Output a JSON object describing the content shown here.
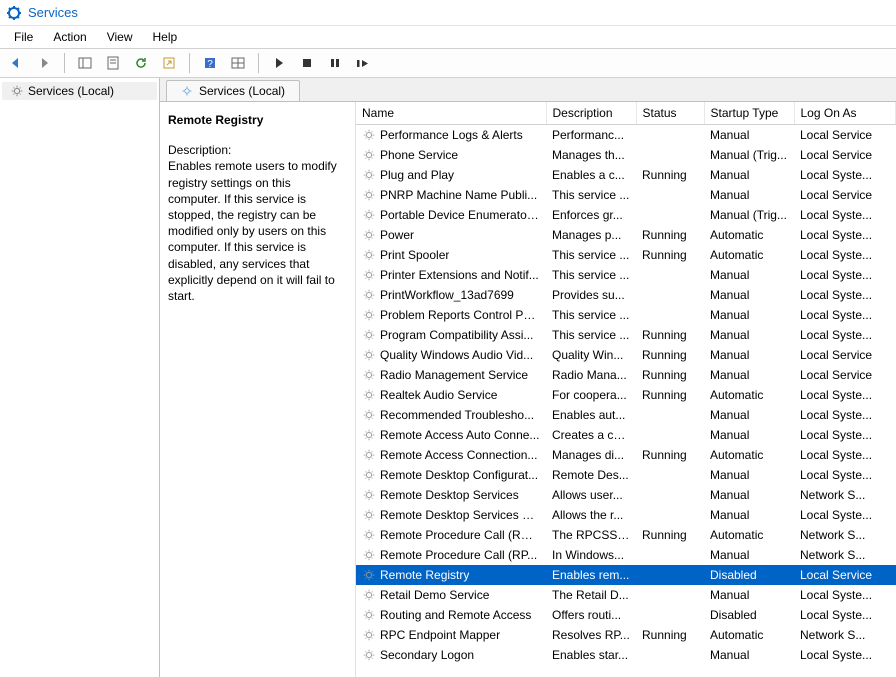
{
  "window": {
    "title": "Services"
  },
  "menu": {
    "file": "File",
    "action": "Action",
    "view": "View",
    "help": "Help"
  },
  "tree": {
    "root": "Services (Local)"
  },
  "tab": {
    "label": "Services (Local)"
  },
  "info": {
    "title": "Remote Registry",
    "desc_label": "Description:",
    "desc": "Enables remote users to modify registry settings on this computer. If this service is stopped, the registry can be modified only by users on this computer. If this service is disabled, any services that explicitly depend on it will fail to start."
  },
  "columns": {
    "name": "Name",
    "description": "Description",
    "status": "Status",
    "startup": "Startup Type",
    "logon": "Log On As"
  },
  "services": [
    {
      "name": "Performance Logs & Alerts",
      "desc": "Performanc...",
      "status": "",
      "startup": "Manual",
      "logon": "Local Service"
    },
    {
      "name": "Phone Service",
      "desc": "Manages th...",
      "status": "",
      "startup": "Manual (Trig...",
      "logon": "Local Service"
    },
    {
      "name": "Plug and Play",
      "desc": "Enables a c...",
      "status": "Running",
      "startup": "Manual",
      "logon": "Local Syste..."
    },
    {
      "name": "PNRP Machine Name Publi...",
      "desc": "This service ...",
      "status": "",
      "startup": "Manual",
      "logon": "Local Service"
    },
    {
      "name": "Portable Device Enumerator...",
      "desc": "Enforces gr...",
      "status": "",
      "startup": "Manual (Trig...",
      "logon": "Local Syste..."
    },
    {
      "name": "Power",
      "desc": "Manages p...",
      "status": "Running",
      "startup": "Automatic",
      "logon": "Local Syste..."
    },
    {
      "name": "Print Spooler",
      "desc": "This service ...",
      "status": "Running",
      "startup": "Automatic",
      "logon": "Local Syste..."
    },
    {
      "name": "Printer Extensions and Notif...",
      "desc": "This service ...",
      "status": "",
      "startup": "Manual",
      "logon": "Local Syste..."
    },
    {
      "name": "PrintWorkflow_13ad7699",
      "desc": "Provides su...",
      "status": "",
      "startup": "Manual",
      "logon": "Local Syste..."
    },
    {
      "name": "Problem Reports Control Pa...",
      "desc": "This service ...",
      "status": "",
      "startup": "Manual",
      "logon": "Local Syste..."
    },
    {
      "name": "Program Compatibility Assi...",
      "desc": "This service ...",
      "status": "Running",
      "startup": "Manual",
      "logon": "Local Syste..."
    },
    {
      "name": "Quality Windows Audio Vid...",
      "desc": "Quality Win...",
      "status": "Running",
      "startup": "Manual",
      "logon": "Local Service"
    },
    {
      "name": "Radio Management Service",
      "desc": "Radio Mana...",
      "status": "Running",
      "startup": "Manual",
      "logon": "Local Service"
    },
    {
      "name": "Realtek Audio Service",
      "desc": "For coopera...",
      "status": "Running",
      "startup": "Automatic",
      "logon": "Local Syste..."
    },
    {
      "name": "Recommended Troublesho...",
      "desc": "Enables aut...",
      "status": "",
      "startup": "Manual",
      "logon": "Local Syste..."
    },
    {
      "name": "Remote Access Auto Conne...",
      "desc": "Creates a co...",
      "status": "",
      "startup": "Manual",
      "logon": "Local Syste..."
    },
    {
      "name": "Remote Access Connection...",
      "desc": "Manages di...",
      "status": "Running",
      "startup": "Automatic",
      "logon": "Local Syste..."
    },
    {
      "name": "Remote Desktop Configurat...",
      "desc": "Remote Des...",
      "status": "",
      "startup": "Manual",
      "logon": "Local Syste..."
    },
    {
      "name": "Remote Desktop Services",
      "desc": "Allows user...",
      "status": "",
      "startup": "Manual",
      "logon": "Network S..."
    },
    {
      "name": "Remote Desktop Services U...",
      "desc": "Allows the r...",
      "status": "",
      "startup": "Manual",
      "logon": "Local Syste..."
    },
    {
      "name": "Remote Procedure Call (RPC)",
      "desc": "The RPCSS s...",
      "status": "Running",
      "startup": "Automatic",
      "logon": "Network S..."
    },
    {
      "name": "Remote Procedure Call (RP...",
      "desc": "In Windows...",
      "status": "",
      "startup": "Manual",
      "logon": "Network S..."
    },
    {
      "name": "Remote Registry",
      "desc": "Enables rem...",
      "status": "",
      "startup": "Disabled",
      "logon": "Local Service",
      "selected": true
    },
    {
      "name": "Retail Demo Service",
      "desc": "The Retail D...",
      "status": "",
      "startup": "Manual",
      "logon": "Local Syste..."
    },
    {
      "name": "Routing and Remote Access",
      "desc": "Offers routi...",
      "status": "",
      "startup": "Disabled",
      "logon": "Local Syste..."
    },
    {
      "name": "RPC Endpoint Mapper",
      "desc": "Resolves RP...",
      "status": "Running",
      "startup": "Automatic",
      "logon": "Network S..."
    },
    {
      "name": "Secondary Logon",
      "desc": "Enables star...",
      "status": "",
      "startup": "Manual",
      "logon": "Local Syste..."
    }
  ]
}
